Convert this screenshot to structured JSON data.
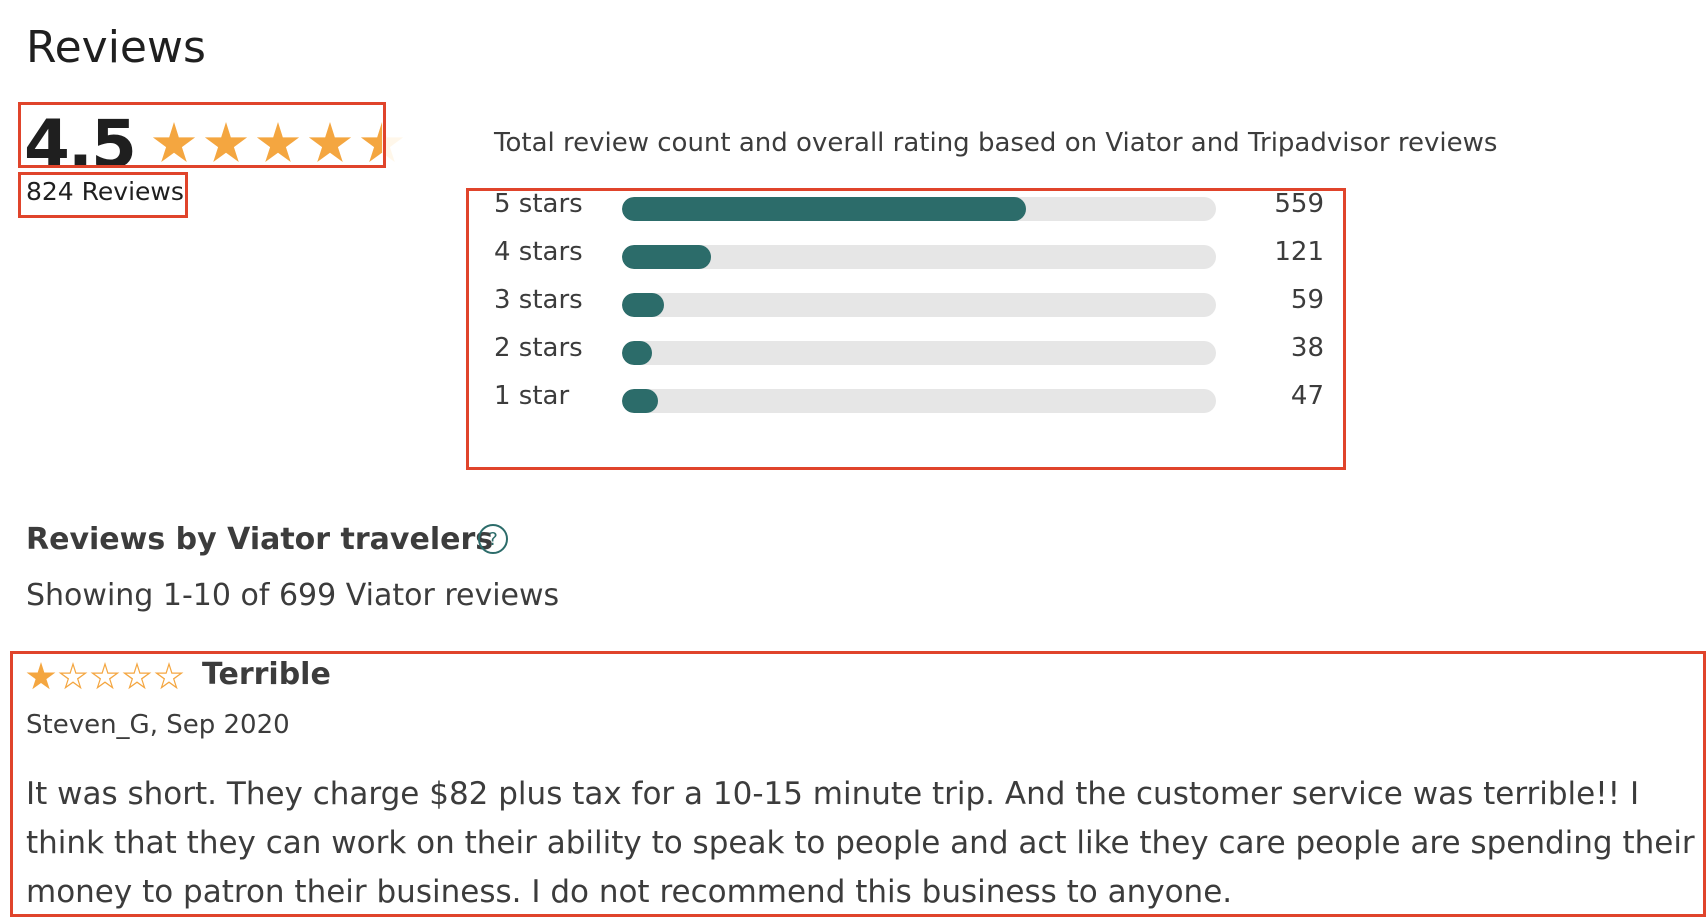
{
  "section_title": "Reviews",
  "summary": {
    "rating": "4.5",
    "rating_value": 4.5,
    "rating_max": 5,
    "reviews_count": "824 Reviews",
    "note": "Total review count and overall rating based on Viator and Tripadvisor reviews"
  },
  "distribution": [
    {
      "label": "5 stars",
      "count": "559",
      "fill_percent": 68
    },
    {
      "label": "4 stars",
      "count": "121",
      "fill_percent": 15
    },
    {
      "label": "3 stars",
      "count": "59",
      "fill_percent": 7
    },
    {
      "label": "2 stars",
      "count": "38",
      "fill_percent": 5
    },
    {
      "label": "1 star",
      "count": "47",
      "fill_percent": 6
    }
  ],
  "travelers": {
    "title": "Reviews by Viator travelers",
    "help_icon": "question-circle-icon",
    "showing": "Showing 1-10 of 699 Viator reviews"
  },
  "review": {
    "stars": 1,
    "stars_max": 5,
    "title": "Terrible",
    "author_date": "Steven_G, Sep 2020",
    "body": "It was short. They charge $82 plus tax for a 10-15 minute trip. And the customer service was terrible!! I think that they can work on their ability to speak to people and act like they care people are spending their money to patron their business. I do not recommend this business to anyone."
  },
  "colors": {
    "accent": "#2c6c6a",
    "star": "#f4a640",
    "track": "#e6e6e6",
    "highlight_border": "#e0442b"
  }
}
